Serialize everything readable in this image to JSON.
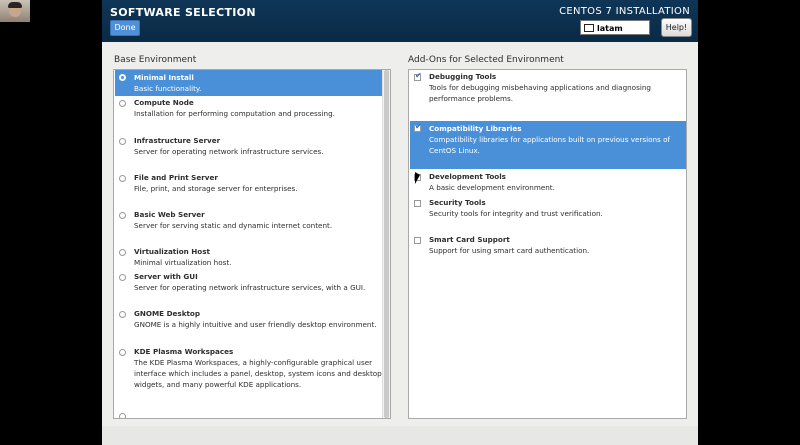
{
  "header": {
    "title": "SOFTWARE SELECTION",
    "done_label": "Done",
    "product": "CENTOS 7 INSTALLATION",
    "keyboard_layout": "latam",
    "help_label": "Help!"
  },
  "base": {
    "label": "Base Environment",
    "selected_index": 0,
    "items": [
      {
        "name": "Minimal Install",
        "desc": "Basic functionality."
      },
      {
        "name": "Compute Node",
        "desc": "Installation for performing computation and processing."
      },
      {
        "name": "Infrastructure Server",
        "desc": "Server for operating network infrastructure services."
      },
      {
        "name": "File and Print Server",
        "desc": "File, print, and storage server for enterprises."
      },
      {
        "name": "Basic Web Server",
        "desc": "Server for serving static and dynamic internet content."
      },
      {
        "name": "Virtualization Host",
        "desc": "Minimal virtualization host."
      },
      {
        "name": "Server with GUI",
        "desc": "Server for operating network infrastructure services, with a GUI."
      },
      {
        "name": "GNOME Desktop",
        "desc": "GNOME is a highly intuitive and user friendly desktop environment."
      },
      {
        "name": "KDE Plasma Workspaces",
        "desc": "The KDE Plasma Workspaces, a highly-configurable graphical user",
        "desc2": "interface which includes a panel, desktop, system icons and desktop",
        "desc3": "widgets, and many powerful KDE applications."
      }
    ]
  },
  "addons": {
    "label": "Add-Ons for Selected Environment",
    "items": [
      {
        "name": "Debugging Tools",
        "desc": "Tools for debugging misbehaving applications and diagnosing",
        "desc2": "performance problems.",
        "checked": true,
        "highlighted": false
      },
      {
        "name": "Compatibility Libraries",
        "desc": "Compatibility libraries for applications built on previous versions of",
        "desc2": "CentOS Linux.",
        "checked": true,
        "highlighted": true
      },
      {
        "name": "Development Tools",
        "desc": "A basic development environment.",
        "checked": false,
        "highlighted": false
      },
      {
        "name": "Security Tools",
        "desc": "Security tools for integrity and trust verification.",
        "checked": false,
        "highlighted": false
      },
      {
        "name": "Smart Card Support",
        "desc": "Support for using smart card authentication.",
        "checked": false,
        "highlighted": false
      }
    ]
  },
  "colors": {
    "header_bg": "#0f3657",
    "selection": "#4a90d9",
    "done_button": "#4f90d8"
  }
}
